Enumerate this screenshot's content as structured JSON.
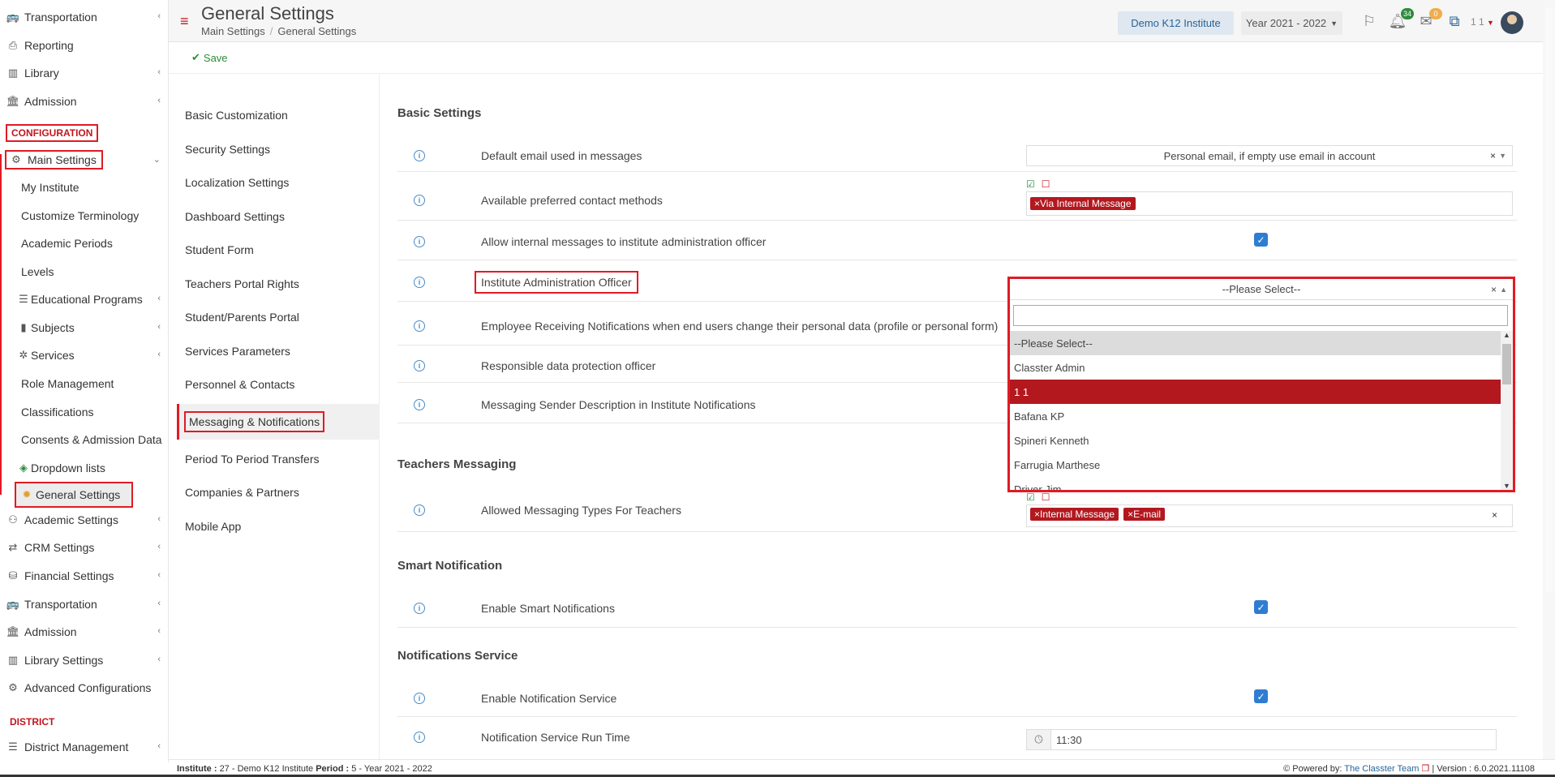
{
  "sidebar": {
    "top_items": [
      {
        "label": "Transportation",
        "icon": "bus-icon",
        "chevron": true
      },
      {
        "label": "Reporting",
        "icon": "printer-icon",
        "chevron": false
      },
      {
        "label": "Library",
        "icon": "books-icon",
        "chevron": true
      },
      {
        "label": "Admission",
        "icon": "bank-icon",
        "chevron": true
      }
    ],
    "config_section": "CONFIGURATION",
    "main_settings": "Main Settings",
    "sub_items": [
      "My Institute",
      "Customize Terminology",
      "Academic Periods",
      "Levels",
      "Educational Programs",
      "Subjects",
      "Services",
      "Role Management",
      "Classifications",
      "Consents & Admission Data",
      "Dropdown lists",
      "General Settings"
    ],
    "bottom_items": [
      "Academic Settings",
      "CRM Settings",
      "Financial Settings",
      "Transportation",
      "Admission",
      "Library Settings",
      "Advanced Configurations"
    ],
    "district_section": "DISTRICT",
    "district_item": "District Management"
  },
  "header": {
    "title": "General Settings",
    "breadcrumb": [
      "Main Settings",
      "General Settings"
    ],
    "institute": "Demo K12 Institute",
    "year": "Year 2021 - 2022",
    "notifications_count": "34",
    "messages_count": "0",
    "user": "1 1"
  },
  "toolbar": {
    "save_label": "Save"
  },
  "settings_nav": [
    "Basic Customization",
    "Security Settings",
    "Localization Settings",
    "Dashboard Settings",
    "Student Form",
    "Teachers Portal Rights",
    "Student/Parents Portal",
    "Services Parameters",
    "Personnel & Contacts",
    "Messaging & Notifications",
    "Period To Period Transfers",
    "Companies & Partners",
    "Mobile App"
  ],
  "content": {
    "basic_settings": "Basic Settings",
    "rows": {
      "default_email": {
        "label": "Default email used in messages",
        "value": "Personal email, if empty use email in account"
      },
      "contact_methods": {
        "label": "Available preferred contact methods",
        "tag": "Via Internal Message"
      },
      "allow_internal": {
        "label": "Allow internal messages to institute administration officer"
      },
      "admin_officer": {
        "label": "Institute Administration Officer",
        "value": "--Please Select--"
      },
      "employee_receiving": {
        "label": "Employee Receiving Notifications when end users change their personal data (profile or personal form)"
      },
      "data_protection": {
        "label": "Responsible data protection officer"
      },
      "sender_desc": {
        "label": "Messaging Sender Description in Institute Notifications"
      }
    },
    "teachers_messaging": "Teachers Messaging",
    "allowed_types": {
      "label": "Allowed Messaging Types For Teachers",
      "tags": [
        "Internal Message",
        "E-mail"
      ]
    },
    "smart_notification": "Smart Notification",
    "enable_smart": {
      "label": "Enable Smart Notifications"
    },
    "notifications_service": "Notifications Service",
    "enable_service": {
      "label": "Enable Notification Service"
    },
    "run_time": {
      "label": "Notification Service Run Time",
      "value": "11:30"
    }
  },
  "dropdown": {
    "selected": "--Please Select--",
    "options": [
      "--Please Select--",
      "Classter Admin",
      "1 1",
      "Bafana KP",
      "Spineri Kenneth",
      "Farrugia Marthese",
      "Driver Jim"
    ]
  },
  "footer": {
    "institute_label": "Institute :",
    "institute_value": "27 - Demo K12 Institute",
    "period_label": "Period :",
    "period_value": "5 - Year 2021 - 2022",
    "powered": "Powered by:",
    "team": "The Classter Team",
    "version": "| Version : 6.0.2021.11108"
  },
  "colors": {
    "accent": "#c0161d",
    "highlight": "#e01b24",
    "tag": "#b3181f",
    "link": "#2a6496",
    "checkbox": "#2f7dd1"
  }
}
